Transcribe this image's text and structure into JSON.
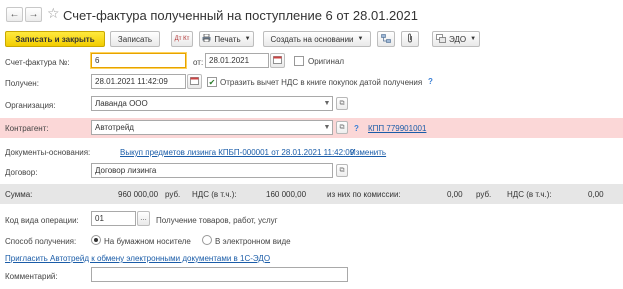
{
  "nav": {
    "back": "←",
    "forward": "→",
    "favorite": "☆"
  },
  "title": "Счет-фактура полученный на поступление 6 от 28.01.2021",
  "toolbar": {
    "post_close": "Записать и закрыть",
    "save": "Записать",
    "dt_kt": "Дт Кт",
    "print": "Печать",
    "create_based": "Создать на основании",
    "edo": "ЭДО"
  },
  "form": {
    "invoice_label": "Счет-фактура №:",
    "invoice_number": "6",
    "from_label": "от:",
    "invoice_date": "28.01.2021",
    "original_label": "Оригинал",
    "received_label": "Получен:",
    "received_date": "28.01.2021 11:42:09",
    "reflect_vat_label": "Отразить вычет НДС в книге покупок датой получения",
    "help": "?",
    "org_label": "Организация:",
    "org_value": "Лаванда ООО",
    "contractor_label": "Контрагент:",
    "contractor_value": "Автотрейд",
    "kpp_link": "КПП 779901001",
    "docs_label": "Документы-основания:",
    "docs_link": "Выкуп предметов лизинга КПБП-000001 от 28.01.2021 11:42:09",
    "change_link": "Изменить",
    "contract_label": "Договор:",
    "contract_value": "Договор лизинга"
  },
  "sum": {
    "sum_label": "Сумма:",
    "sum_value": "960 000,00",
    "currency1": "руб.",
    "vat_label1": "НДС (в т.ч.):",
    "vat_value1": "160 000,00",
    "commission_label": "из них по комиссии:",
    "commission_value": "0,00",
    "currency2": "руб.",
    "vat_label2": "НДС (в т.ч.):",
    "vat_value2": "0,00"
  },
  "operation": {
    "code_label": "Код вида операции:",
    "code_value": "01",
    "code_desc": "Получение товаров, работ, услуг",
    "method_label": "Способ получения:",
    "paper_option": "На бумажном носителе",
    "electronic_option": "В электронном виде",
    "invite_link": "Пригласить Автотрейд к обмену электронными документами в 1С-ЭДО",
    "comment_label": "Комментарий:",
    "comment_value": ""
  },
  "colors": {
    "accent": "#f2cc00",
    "contractor_bg": "#fbd7d7",
    "link": "#1a5ca8"
  }
}
